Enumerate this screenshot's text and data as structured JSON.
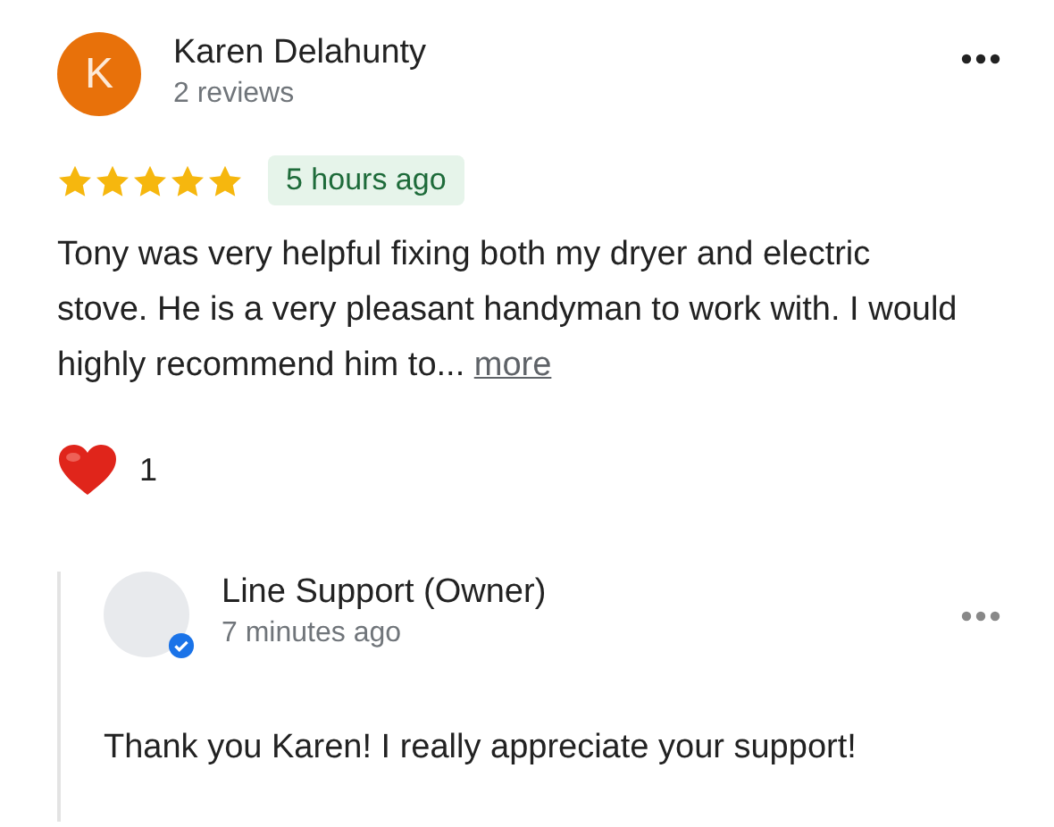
{
  "review": {
    "avatar_letter": "K",
    "author": "Karen Delahunty",
    "reviews_count": "2 reviews",
    "stars": 5,
    "time": "5 hours ago",
    "text": "Tony was very helpful fixing both my dryer and electric stove. He is a very pleasant handyman to work with. I would highly recommend him to...",
    "more_link": "more",
    "reaction_count": "1"
  },
  "reply": {
    "author": "Line Support (Owner)",
    "verified": true,
    "time": "7 minutes ago",
    "text": "Thank you Karen! I really appreciate your support!"
  }
}
